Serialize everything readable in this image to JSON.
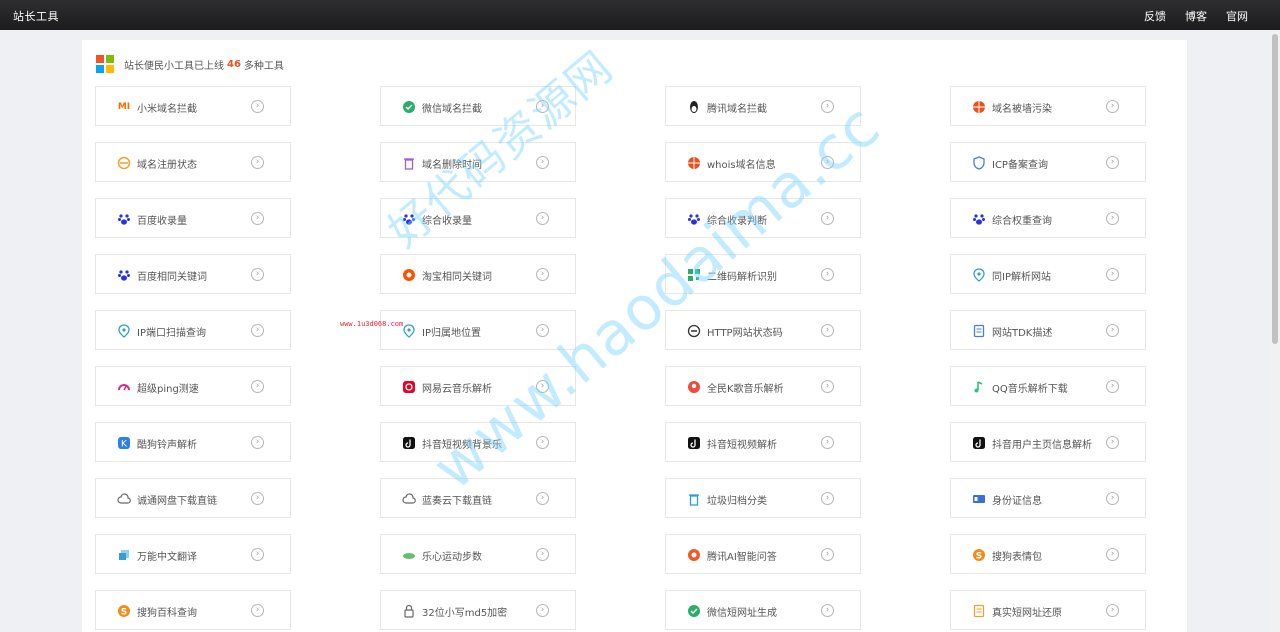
{
  "nav": {
    "brand": "站长工具",
    "links": [
      "反馈",
      "博客",
      "官网"
    ]
  },
  "header": {
    "prefix": "站长便民小工具已上线",
    "count": "46",
    "suffix": "多种工具",
    "logo_colors": [
      "#f35325",
      "#81bc06",
      "#05a6f0",
      "#ffba08"
    ]
  },
  "tools": [
    {
      "name": "小米域名拦截",
      "icon": "mi-icon",
      "color": "#ff6700"
    },
    {
      "name": "微信域名拦截",
      "icon": "wechat-icon",
      "color": "#2aae67"
    },
    {
      "name": "腾讯域名拦截",
      "icon": "qq-penguin-icon",
      "color": "#222222"
    },
    {
      "name": "域名被墙污染",
      "icon": "globe-icon",
      "color": "#e8531d"
    },
    {
      "name": "域名注册状态",
      "icon": "domain-icon",
      "color": "#f0a030"
    },
    {
      "name": "域名删除时间",
      "icon": "trash-icon",
      "color": "#a25bd6"
    },
    {
      "name": "whois域名信息",
      "icon": "globe-icon",
      "color": "#e8531d"
    },
    {
      "name": "ICP备案查询",
      "icon": "shield-icon",
      "color": "#4a7fd6"
    },
    {
      "name": "百度收录量",
      "icon": "baidu-paw-icon",
      "color": "#2932e1"
    },
    {
      "name": "综合收录量",
      "icon": "baidu-paw-icon",
      "color": "#2932e1"
    },
    {
      "name": "综合收录判断",
      "icon": "baidu-paw-icon",
      "color": "#2932e1"
    },
    {
      "name": "综合权重查询",
      "icon": "baidu-paw-icon",
      "color": "#2932e1"
    },
    {
      "name": "百度相同关键词",
      "icon": "baidu-paw-icon",
      "color": "#2932e1"
    },
    {
      "name": "淘宝相同关键词",
      "icon": "taobao-icon",
      "color": "#ff5000"
    },
    {
      "name": "二维码解析识别",
      "icon": "qrcode-icon",
      "color": "#2aae67"
    },
    {
      "name": "同IP解析网站",
      "icon": "location-icon",
      "color": "#2f9fd6"
    },
    {
      "name": "IP端口扫描查询",
      "icon": "location-icon",
      "color": "#2f9fd6"
    },
    {
      "name": "IP归属地位置",
      "icon": "location-icon",
      "color": "#2f9fd6"
    },
    {
      "name": "HTTP网站状态码",
      "icon": "status-icon",
      "color": "#333333"
    },
    {
      "name": "网站TDK描述",
      "icon": "document-icon",
      "color": "#4a7fd6"
    },
    {
      "name": "超级ping测速",
      "icon": "speedometer-icon",
      "color": "#e0287a"
    },
    {
      "name": "网易云音乐解析",
      "icon": "netease-music-icon",
      "color": "#e60026"
    },
    {
      "name": "全民K歌音乐解析",
      "icon": "kge-icon",
      "color": "#f04a3a"
    },
    {
      "name": "QQ音乐解析下载",
      "icon": "qq-music-icon",
      "color": "#31c27c"
    },
    {
      "name": "酷狗铃声解析",
      "icon": "kugou-icon",
      "color": "#2f7fe8"
    },
    {
      "name": "抖音短视频背景乐",
      "icon": "douyin-icon",
      "color": "#111111"
    },
    {
      "name": "抖音短视频解析",
      "icon": "douyin-icon",
      "color": "#111111"
    },
    {
      "name": "抖音用户主页信息解析",
      "icon": "douyin-icon",
      "color": "#111111"
    },
    {
      "name": "诚通网盘下载直链",
      "icon": "cloud-icon",
      "color": "#666666"
    },
    {
      "name": "蓝奏云下载直链",
      "icon": "cloud-icon",
      "color": "#666666"
    },
    {
      "name": "垃圾归档分类",
      "icon": "bin-icon",
      "color": "#2f9fd6"
    },
    {
      "name": "身份证信息",
      "icon": "id-card-icon",
      "color": "#3b6ed6"
    },
    {
      "name": "万能中文翻译",
      "icon": "translate-icon",
      "color": "#2f9fd6"
    },
    {
      "name": "乐心运动步数",
      "icon": "steps-icon",
      "color": "#3bb04a"
    },
    {
      "name": "腾讯AI智能问答",
      "icon": "ai-icon",
      "color": "#f05a28"
    },
    {
      "name": "搜狗表情包",
      "icon": "sogou-icon",
      "color": "#f28c18"
    },
    {
      "name": "搜狗百科查询",
      "icon": "sogou-icon",
      "color": "#f28c18"
    },
    {
      "name": "32位小写md5加密",
      "icon": "lock-icon",
      "color": "#666666"
    },
    {
      "name": "微信短网址生成",
      "icon": "wechat-check-icon",
      "color": "#2aae67"
    },
    {
      "name": "真实短网址还原",
      "icon": "link-doc-icon",
      "color": "#f0a030"
    }
  ],
  "watermark": {
    "cn": "好代码资源网",
    "en": "www.haodaima.cc",
    "small": "www.1u3d068.com"
  }
}
